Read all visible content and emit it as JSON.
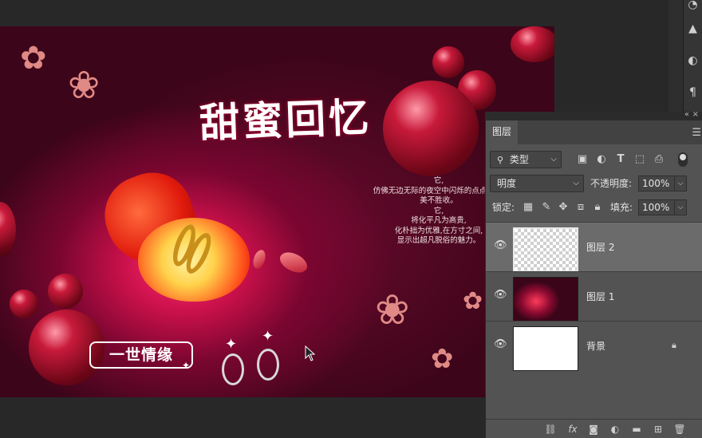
{
  "canvas": {
    "title_art": "甜蜜回忆",
    "poem_lines": [
      "它,",
      "仿佛无边无际的夜空中闪烁的点点繁星,",
      "美不胜收。",
      "它,",
      "将化平凡为高贵,",
      "化朴拙为优雅,在方寸之间,",
      "显示出超凡脱俗的魅力。"
    ],
    "badge_text": "一世情缘"
  },
  "right_toolbar": {
    "icons": [
      "adjust-icon",
      "stamp-icon",
      "contrast-icon",
      "paragraph-icon"
    ]
  },
  "layers_panel": {
    "tab_label": "图层",
    "filter_select": "类型",
    "filter_icons": [
      "image-filter-icon",
      "adjustment-filter-icon",
      "type-filter-icon",
      "shape-filter-icon",
      "smart-object-filter-icon"
    ],
    "blend_mode": "明度",
    "opacity_label": "不透明度:",
    "opacity_value": "100%",
    "lock_label": "锁定:",
    "fill_label": "填充:",
    "fill_value": "100%",
    "layers": [
      {
        "name": "图层 2",
        "selected": true,
        "thumb": "transparent"
      },
      {
        "name": "图层 1",
        "selected": false,
        "thumb": "artwork"
      },
      {
        "name": "背景",
        "selected": false,
        "thumb": "white",
        "locked": true
      }
    ],
    "footer_icons": [
      "link-icon",
      "fx-icon",
      "mask-icon",
      "adjustment-layer-icon",
      "folder-icon",
      "new-layer-icon",
      "trash-icon"
    ],
    "fx_label": "fx"
  },
  "colors": {
    "panel_bg": "#535353",
    "selected_row": "#6b6b6b",
    "workspace": "#282828"
  }
}
